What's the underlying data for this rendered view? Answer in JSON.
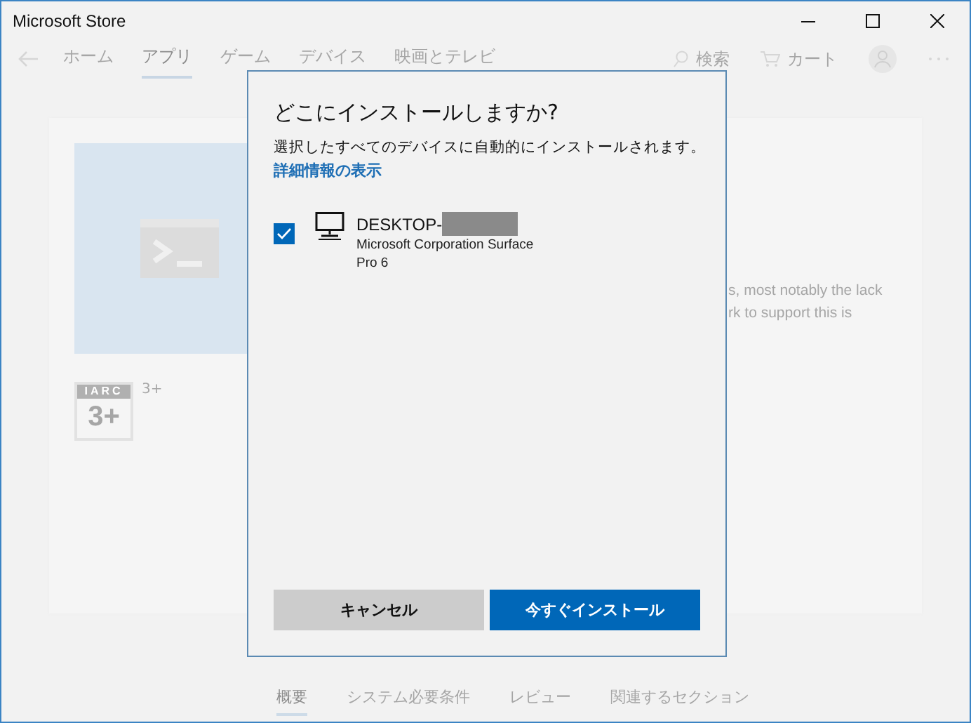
{
  "window": {
    "title": "Microsoft Store"
  },
  "nav": {
    "tabs": [
      {
        "label": "ホーム",
        "selected": false
      },
      {
        "label": "アプリ",
        "selected": true
      },
      {
        "label": "ゲーム",
        "selected": false
      },
      {
        "label": "デバイス",
        "selected": false
      },
      {
        "label": "映画とテレビ",
        "selected": false
      }
    ],
    "search": "検索",
    "cart": "カート"
  },
  "product": {
    "rating_badge": {
      "label": "IARC",
      "age": "3+"
    },
    "rating_text": "3+",
    "description_lines": [
      "s, most notably the lack",
      "rk to support this is"
    ]
  },
  "section_tabs": [
    {
      "label": "概要",
      "selected": true
    },
    {
      "label": "システム必要条件",
      "selected": false
    },
    {
      "label": "レビュー",
      "selected": false
    },
    {
      "label": "関連するセクション",
      "selected": false
    }
  ],
  "dialog": {
    "title": "どこにインストールしますか?",
    "message": "選択したすべてのデバイスに自動的にインストールされます。",
    "link": "詳細情報の表示",
    "devices": [
      {
        "name": "DESKTOP-",
        "redacted": true,
        "model": "Microsoft Corporation Surface Pro 6",
        "checked": true
      }
    ],
    "buttons": [
      {
        "label": "キャンセル",
        "kind": "secondary"
      },
      {
        "label": "今すぐインストール",
        "kind": "primary"
      }
    ]
  }
}
